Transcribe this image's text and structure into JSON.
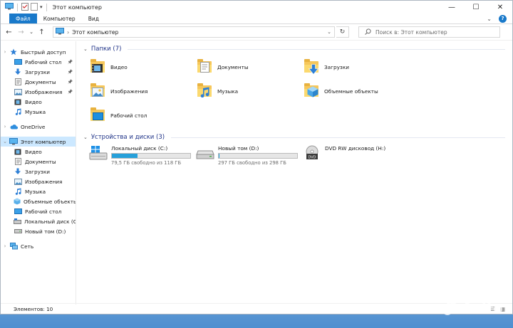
{
  "window": {
    "title": "Этот компьютер",
    "controls": {
      "minimize": "—",
      "maximize": "☐",
      "close": "✕"
    }
  },
  "ribbon": {
    "tabs": [
      "Файл",
      "Компьютер",
      "Вид"
    ],
    "expand": "⌄",
    "help": "?"
  },
  "addressbar": {
    "back": "←",
    "forward": "→",
    "recent": "⌄",
    "up": "↑",
    "crumb_sep": "›",
    "crumb": "Этот компьютер",
    "dropdown": "⌄",
    "refresh": "↻",
    "search_placeholder": "Поиск в: Этот компьютер"
  },
  "nav": {
    "quick_access": {
      "label": "Быстрый доступ",
      "items": [
        {
          "label": "Рабочий стол",
          "icon": "desktop-icon",
          "pinned": true
        },
        {
          "label": "Загрузки",
          "icon": "downloads-icon",
          "pinned": true
        },
        {
          "label": "Документы",
          "icon": "documents-icon",
          "pinned": true
        },
        {
          "label": "Изображения",
          "icon": "pictures-icon",
          "pinned": true
        },
        {
          "label": "Видео",
          "icon": "videos-icon",
          "pinned": false
        },
        {
          "label": "Музыка",
          "icon": "music-icon",
          "pinned": false
        }
      ]
    },
    "onedrive": "OneDrive",
    "this_pc": {
      "label": "Этот компьютер",
      "items": [
        {
          "label": "Видео",
          "icon": "videos-icon"
        },
        {
          "label": "Документы",
          "icon": "documents-icon"
        },
        {
          "label": "Загрузки",
          "icon": "downloads-icon"
        },
        {
          "label": "Изображения",
          "icon": "pictures-icon"
        },
        {
          "label": "Музыка",
          "icon": "music-icon"
        },
        {
          "label": "Объемные объекты",
          "icon": "3d-objects-icon"
        },
        {
          "label": "Рабочий стол",
          "icon": "desktop-icon"
        },
        {
          "label": "Локальный диск (C",
          "icon": "drive-c-icon"
        },
        {
          "label": "Новый том (D:)",
          "icon": "drive-d-icon"
        }
      ]
    },
    "network": "Сеть"
  },
  "folders_section": {
    "title": "Папки (7)",
    "items": [
      {
        "label": "Видео",
        "icon": "videos-folder-icon"
      },
      {
        "label": "Документы",
        "icon": "documents-folder-icon"
      },
      {
        "label": "Загрузки",
        "icon": "downloads-folder-icon"
      },
      {
        "label": "Изображения",
        "icon": "pictures-folder-icon"
      },
      {
        "label": "Музыка",
        "icon": "music-folder-icon"
      },
      {
        "label": "Объемные объекты",
        "icon": "3d-objects-folder-icon"
      },
      {
        "label": "Рабочий стол",
        "icon": "desktop-folder-icon"
      }
    ]
  },
  "drives_section": {
    "title": "Устройства и диски (3)",
    "items": [
      {
        "label": "Локальный диск (C:)",
        "free": "79,5 ГБ свободно из 118 ГБ",
        "used_fraction": 0.33,
        "icon": "windows-drive-icon"
      },
      {
        "label": "Новый том (D:)",
        "free": "297 ГБ свободно из 298 ГБ",
        "used_fraction": 0.003,
        "icon": "hard-drive-icon"
      },
      {
        "label": "DVD RW дисковод (H:)",
        "icon": "dvd-drive-icon"
      }
    ]
  },
  "status": {
    "items_count": "Элементов: 10"
  },
  "watermark": "Avito",
  "colors": {
    "accent": "#1979ca",
    "selection": "#cce8ff",
    "bar_fill": "#26a0da",
    "folder": "#f6c75b"
  }
}
